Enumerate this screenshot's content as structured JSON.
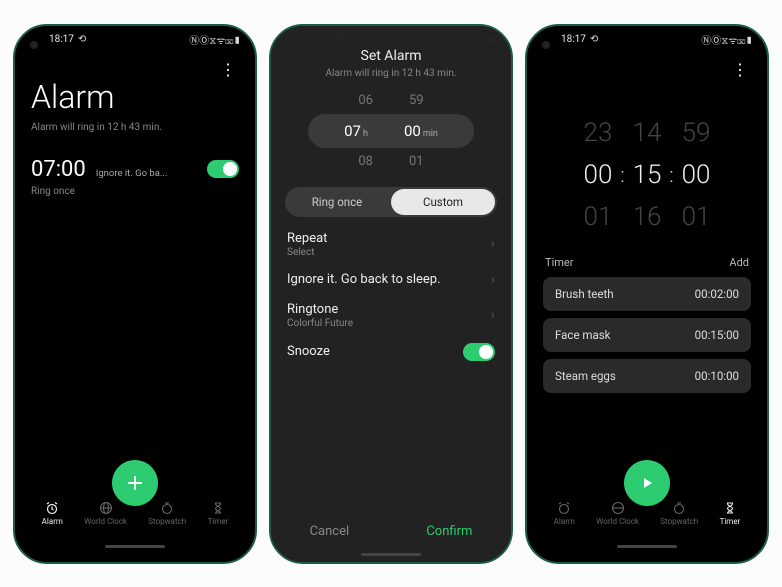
{
  "status": {
    "time": "18:17",
    "icon1": "⟲",
    "right": "ⓃⓄ⧖ᯤ⌧▮"
  },
  "phone1": {
    "title": "Alarm",
    "subtitle": "Alarm will ring in 12 h 43 min.",
    "alarm": {
      "time": "07:00",
      "label": "Ignore it. Go ba...",
      "repeat": "Ring once"
    },
    "nav": [
      "Alarm",
      "World Clock",
      "Stopwatch",
      "Timer"
    ]
  },
  "phone2": {
    "header": "Set Alarm",
    "subtitle": "Alarm will ring in 12 h 43 min.",
    "picker": {
      "above": [
        "06",
        "59"
      ],
      "sel_h": "07",
      "sel_m": "00",
      "below": [
        "08",
        "01"
      ],
      "h_unit": "h",
      "m_unit": "min"
    },
    "seg": [
      "Ring once",
      "Custom"
    ],
    "repeat": {
      "label": "Repeat",
      "value": "Select"
    },
    "name": "Ignore it. Go back to sleep.",
    "ringtone": {
      "label": "Ringtone",
      "value": "Colorful Future"
    },
    "snooze": "Snooze",
    "cancel": "Cancel",
    "confirm": "Confirm"
  },
  "phone3": {
    "picker": {
      "h": [
        "23",
        "00",
        "01"
      ],
      "m": [
        "14",
        "15",
        "16"
      ],
      "s": [
        "59",
        "00",
        "01"
      ]
    },
    "head_left": "Timer",
    "head_right": "Add",
    "items": [
      {
        "name": "Brush teeth",
        "dur": "00:02:00"
      },
      {
        "name": "Face mask",
        "dur": "00:15:00"
      },
      {
        "name": "Steam eggs",
        "dur": "00:10:00"
      }
    ],
    "nav": [
      "Alarm",
      "World Clock",
      "Stopwatch",
      "Timer"
    ]
  }
}
